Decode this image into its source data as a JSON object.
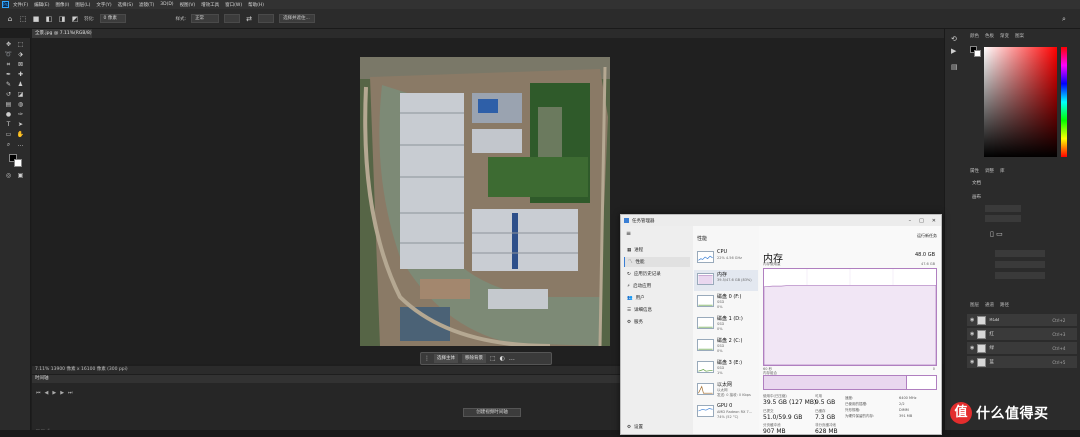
{
  "photoshop": {
    "menu": [
      "文件(F)",
      "编辑(E)",
      "图像(I)",
      "图层(L)",
      "文字(Y)",
      "选择(S)",
      "滤镜(T)",
      "3D(D)",
      "视图(V)",
      "增效工具",
      "窗口(W)",
      "帮助(H)"
    ],
    "options": {
      "feather_label": "羽化:",
      "feather_value": "0 像素",
      "style_label": "样式:",
      "style_value": "正常",
      "select_mask_button": "选择并遮住..."
    },
    "document_tab": "全景.jpg @ 7.11%(RGB/8)",
    "context_bar": {
      "select_subject": "选择主体",
      "remove_bg": "移除背景"
    },
    "status_bar": "7.11%   13900 像素 x 16100 像素 (300 ppi)",
    "timeline_tab": "时间轴",
    "create_timeline_button": "创建视频时间轴",
    "panels": {
      "color_tabs": [
        "颜色",
        "色板",
        "渐变",
        "图案"
      ],
      "properties_tabs": [
        "属性",
        "调整",
        "库"
      ],
      "document_label": "文档",
      "canvas_label": "画布",
      "layers_tabs": [
        "图层",
        "通道",
        "路径"
      ],
      "layers": [
        {
          "name": "RGB",
          "shortcut": "Ctrl+2"
        },
        {
          "name": "红",
          "shortcut": "Ctrl+3"
        },
        {
          "name": "绿",
          "shortcut": "Ctrl+4"
        },
        {
          "name": "蓝",
          "shortcut": "Ctrl+5"
        }
      ]
    }
  },
  "task_manager": {
    "title": "任务管理器",
    "nav": [
      "进程",
      "性能",
      "应用历史记录",
      "启动应用",
      "用户",
      "详细信息",
      "服务"
    ],
    "nav_settings": "设置",
    "section_header": "性能",
    "resources": [
      {
        "name": "CPU",
        "s1": "22%  4.56 GHz",
        "s2": ""
      },
      {
        "name": "内存",
        "s1": "39.5/47.6 GB (83%)",
        "s2": ""
      },
      {
        "name": "磁盘 0 (F:)",
        "s1": "SSD",
        "s2": "0%"
      },
      {
        "name": "磁盘 1 (D:)",
        "s1": "SSD",
        "s2": "0%"
      },
      {
        "name": "磁盘 2 (C:)",
        "s1": "SSD",
        "s2": "0%"
      },
      {
        "name": "磁盘 3 (E:)",
        "s1": "SSD",
        "s2": "1%"
      },
      {
        "name": "以太网",
        "s1": "以太网",
        "s2": "发送: 0 接收: 0 Kbps"
      },
      {
        "name": "GPU 0",
        "s1": "AMD Radeon RX 7...",
        "s2": "74% (52 °C)"
      }
    ],
    "run_new_task": "运行新任务",
    "memory": {
      "title": "内存",
      "total": "48.0 GB",
      "usage_label": "内存使用量",
      "usage_max": "47.6 GB",
      "graph_left": "60 秒",
      "graph_right": "0",
      "composition_label": "内存组合",
      "composition_used_fraction": 0.83,
      "in_use_label": "使用中(已压缩)",
      "in_use": "39.5 GB (127 MB)",
      "available_label": "可用",
      "available": "9.5 GB",
      "committed_label": "已提交",
      "committed": "51.0/59.9 GB",
      "cached_label": "已缓存",
      "cached": "7.3 GB",
      "paged_pool_label": "分页缓冲池",
      "paged_pool": "907 MB",
      "nonpaged_pool_label": "非分页缓冲池",
      "nonpaged_pool": "628 MB",
      "specs": [
        {
          "k": "速度:",
          "v": "6400 MHz"
        },
        {
          "k": "已使用的插槽:",
          "v": "2/2"
        },
        {
          "k": "外形规格:",
          "v": "DIMM"
        },
        {
          "k": "为硬件保留的内存:",
          "v": "391 MB"
        }
      ]
    }
  },
  "watermark": {
    "text": "什么值得买",
    "logo_char": "值"
  },
  "colors": {
    "accent": "#3a7fd5",
    "memory_purple": "#b07fc0",
    "ps_blue": "#31a8ff",
    "smzdm_red": "#e32d2d"
  }
}
